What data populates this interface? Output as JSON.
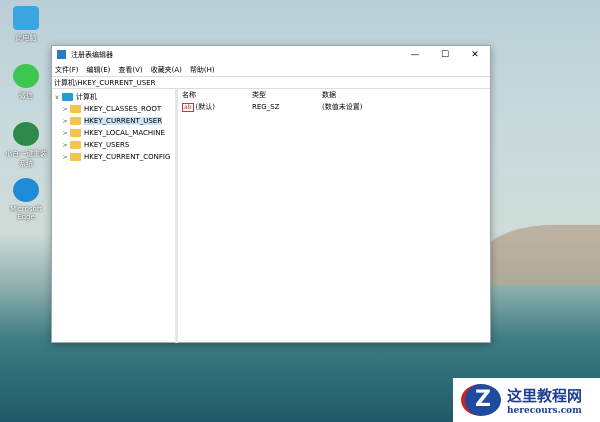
{
  "desktop": {
    "icons": [
      {
        "label": "此电脑",
        "color": "#3aa5e0"
      },
      {
        "label": "微信",
        "color": "#3fc650"
      },
      {
        "label": "小白一键重装系统",
        "color": "#2e8a4a"
      },
      {
        "label": "Microsoft Edge",
        "color": "#1e8bd6"
      }
    ]
  },
  "window": {
    "title": "注册表编辑器",
    "controls": [
      "—",
      "☐",
      "✕"
    ],
    "menu": [
      "文件(F)",
      "编辑(E)",
      "查看(V)",
      "收藏夹(A)",
      "帮助(H)"
    ],
    "address": "计算机\\HKEY_CURRENT_USER",
    "tree": {
      "root": "计算机",
      "keys": [
        "HKEY_CLASSES_ROOT",
        "HKEY_CURRENT_USER",
        "HKEY_LOCAL_MACHINE",
        "HKEY_USERS",
        "HKEY_CURRENT_CONFIG"
      ]
    },
    "columns": [
      "名称",
      "类型",
      "数据"
    ],
    "values": [
      {
        "icon": "ab",
        "name": "(默认)",
        "type": "REG_SZ",
        "data": "(数值未设置)"
      }
    ]
  },
  "watermark": {
    "title": "这里教程网",
    "url": "herecours.com",
    "letter": "Z"
  }
}
